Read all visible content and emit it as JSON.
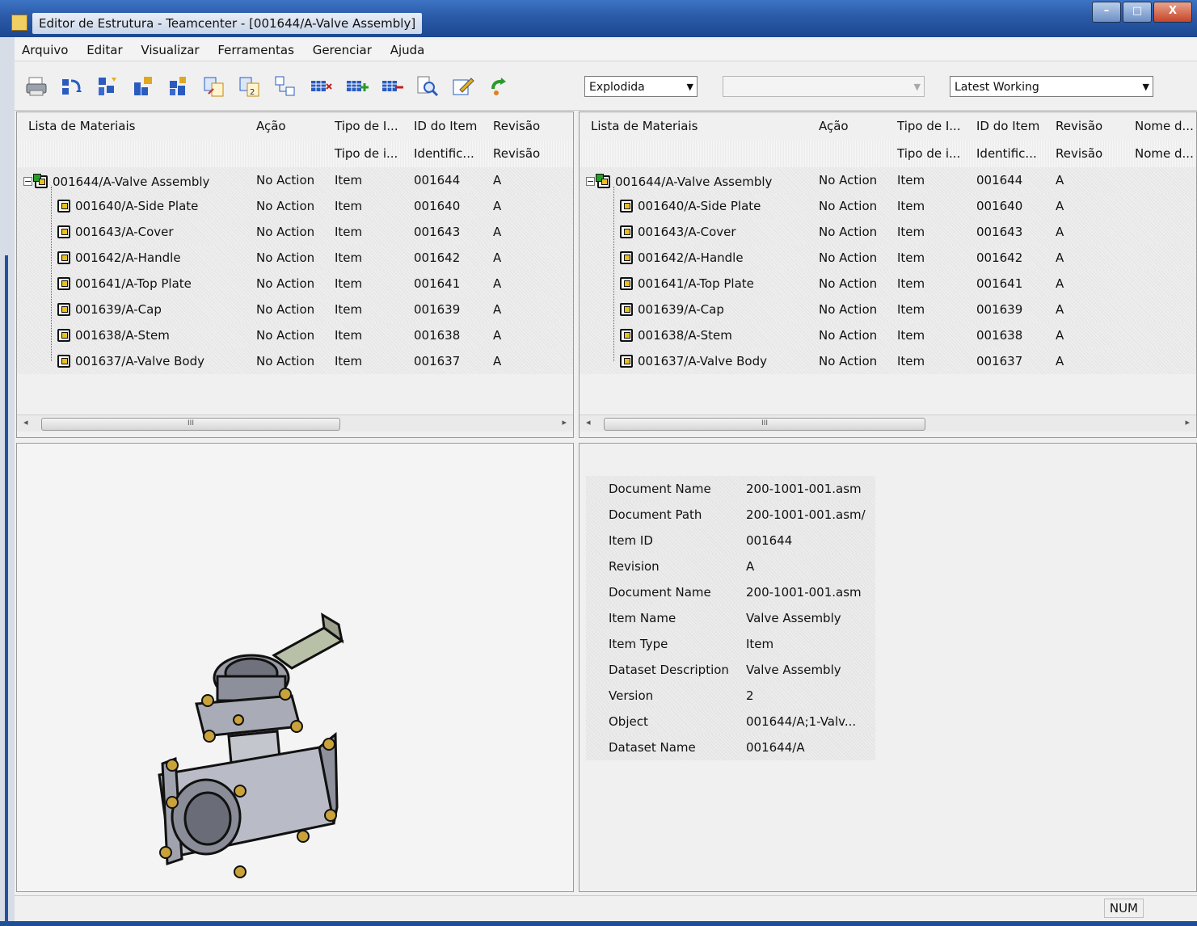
{
  "window": {
    "title": "Editor de Estrutura - Teamcenter - [001644/A-Valve Assembly]",
    "buttons": {
      "minimize": "–",
      "maximize": "□",
      "close": "X"
    }
  },
  "menu": [
    "Arquivo",
    "Editar",
    "Visualizar",
    "Ferramentas",
    "Gerenciar",
    "Ajuda"
  ],
  "toolbar": {
    "icons": [
      "print-icon",
      "refresh-structure-icon",
      "structure-icon",
      "add-item-icon",
      "paste-structure-icon",
      "number-icon",
      "number-two-icon",
      "compare-icon",
      "table-edit-icon",
      "table-add-icon",
      "table-remove-icon",
      "find-icon",
      "edit-icon",
      "recycle-icon"
    ],
    "view_mode": "Explodida",
    "middle_select": "",
    "revision_rule": "Latest Working"
  },
  "bom_left": {
    "columns": [
      "Lista de Materiais",
      "Ação",
      "Tipo de I...",
      "ID do Item",
      "Revisão"
    ],
    "subheaders": [
      "",
      "",
      "Tipo de i...",
      "Identific...",
      "Revisão"
    ],
    "rows": [
      {
        "name": "001644/A-Valve Assembly",
        "action": "No Action",
        "type": "Item",
        "id": "001644",
        "rev": "A"
      },
      {
        "name": "001640/A-Side Plate",
        "action": "No Action",
        "type": "Item",
        "id": "001640",
        "rev": "A"
      },
      {
        "name": "001643/A-Cover",
        "action": "No Action",
        "type": "Item",
        "id": "001643",
        "rev": "A"
      },
      {
        "name": "001642/A-Handle",
        "action": "No Action",
        "type": "Item",
        "id": "001642",
        "rev": "A"
      },
      {
        "name": "001641/A-Top Plate",
        "action": "No Action",
        "type": "Item",
        "id": "001641",
        "rev": "A"
      },
      {
        "name": "001639/A-Cap",
        "action": "No Action",
        "type": "Item",
        "id": "001639",
        "rev": "A"
      },
      {
        "name": "001638/A-Stem",
        "action": "No Action",
        "type": "Item",
        "id": "001638",
        "rev": "A"
      },
      {
        "name": "001637/A-Valve Body",
        "action": "No Action",
        "type": "Item",
        "id": "001637",
        "rev": "A"
      }
    ],
    "scroll_thumb": "III"
  },
  "bom_right": {
    "columns": [
      "Lista de Materiais",
      "Ação",
      "Tipo de I...",
      "ID do Item",
      "Revisão",
      "Nome d..."
    ],
    "subheaders": [
      "",
      "",
      "Tipo de i...",
      "Identific...",
      "Revisão",
      "Nome d..."
    ],
    "rows": [
      {
        "name": "001644/A-Valve Assembly",
        "action": "No Action",
        "type": "Item",
        "id": "001644",
        "rev": "A"
      },
      {
        "name": "001640/A-Side Plate",
        "action": "No Action",
        "type": "Item",
        "id": "001640",
        "rev": "A"
      },
      {
        "name": "001643/A-Cover",
        "action": "No Action",
        "type": "Item",
        "id": "001643",
        "rev": "A"
      },
      {
        "name": "001642/A-Handle",
        "action": "No Action",
        "type": "Item",
        "id": "001642",
        "rev": "A"
      },
      {
        "name": "001641/A-Top Plate",
        "action": "No Action",
        "type": "Item",
        "id": "001641",
        "rev": "A"
      },
      {
        "name": "001639/A-Cap",
        "action": "No Action",
        "type": "Item",
        "id": "001639",
        "rev": "A"
      },
      {
        "name": "001638/A-Stem",
        "action": "No Action",
        "type": "Item",
        "id": "001638",
        "rev": "A"
      },
      {
        "name": "001637/A-Valve Body",
        "action": "No Action",
        "type": "Item",
        "id": "001637",
        "rev": "A"
      }
    ],
    "scroll_thumb": "III"
  },
  "properties": [
    {
      "key": "Document Name",
      "value": "200-1001-001.asm"
    },
    {
      "key": "Document Path",
      "value": "200-1001-001.asm/"
    },
    {
      "key": "Item ID",
      "value": "001644"
    },
    {
      "key": "Revision",
      "value": "A"
    },
    {
      "key": "Document Name",
      "value": "200-1001-001.asm"
    },
    {
      "key": "Item Name",
      "value": "Valve Assembly"
    },
    {
      "key": "Item Type",
      "value": "Item"
    },
    {
      "key": "Dataset Description",
      "value": "Valve Assembly"
    },
    {
      "key": "Version",
      "value": "2"
    },
    {
      "key": "Object",
      "value": "001644/A;1-Valv..."
    },
    {
      "key": "Dataset Name",
      "value": "001644/A"
    }
  ],
  "status": {
    "num": "NUM"
  },
  "colors": {
    "title_bar": "#2a5aa8",
    "valve_body": "#b9bcc6",
    "bolt": "#c9a23a",
    "handle": "#b8c0a8"
  }
}
